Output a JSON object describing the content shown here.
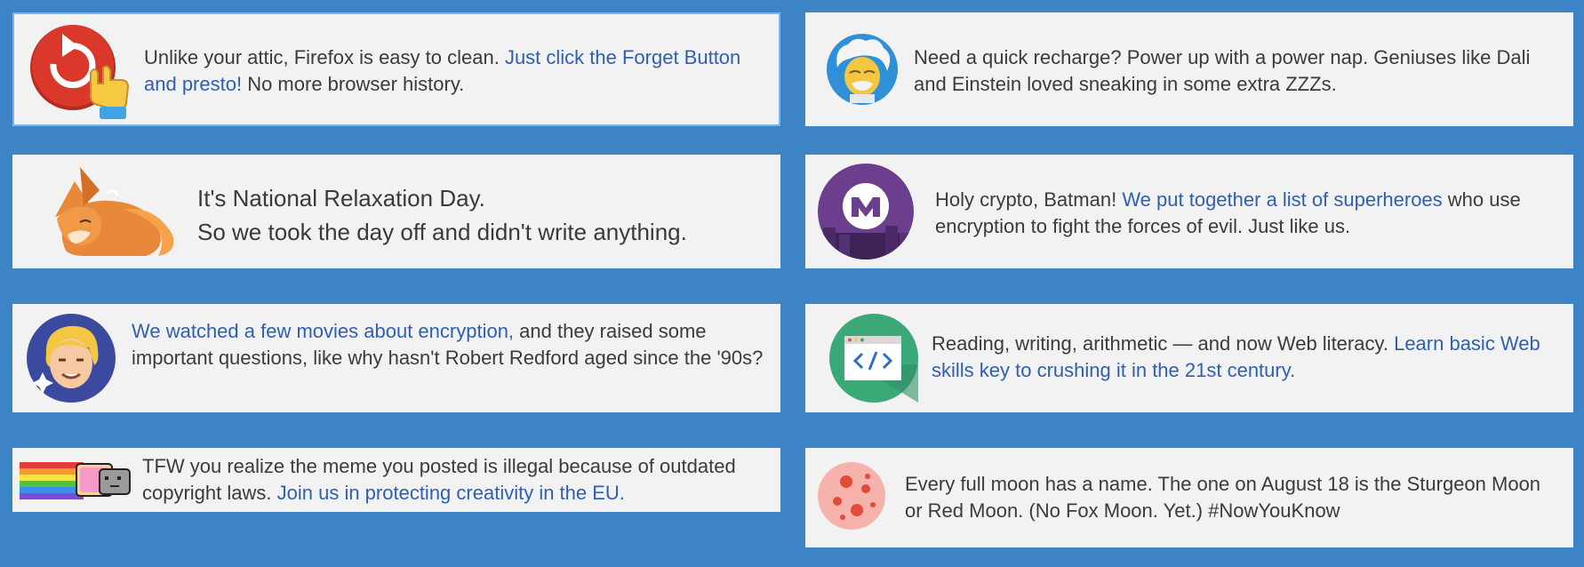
{
  "colors": {
    "background": "#3d84c6",
    "card": "#f2f2f2",
    "link": "#2f5fb3",
    "text": "#3b3b3b"
  },
  "snippets": [
    {
      "icon": "forget-button-icon",
      "text_pre": "Unlike your attic, Firefox is easy to clean. ",
      "link": "Just click the Forget Button and presto!",
      "text_post": " No more browser history."
    },
    {
      "icon": "einstein-icon",
      "text": "Need a quick recharge? Power up with a power nap. Geniuses like Dali and Einstein loved sneaking in some extra ZZZs."
    },
    {
      "icon": "sleeping-fox-icon",
      "line1": "It's National Relaxation Day.",
      "line2": "So we took the day off and didn't write anything."
    },
    {
      "icon": "mozilla-superhero-icon",
      "text_pre": "Holy crypto, Batman! ",
      "link": "We put together a list of superheroes",
      "text_post": " who use encryption to fight the forces of evil. Just like us."
    },
    {
      "icon": "robert-redford-icon",
      "link": "We watched a few movies about encryption,",
      "text_post": " and they raised some important questions, like why hasn't Robert Redford aged since the '90s?"
    },
    {
      "icon": "code-window-icon",
      "text_pre": "Reading, writing, arithmetic — and now Web literacy. ",
      "link": "Learn basic Web skills key to crushing it in the 21st century."
    },
    {
      "icon": "nyan-cat-icon",
      "text_pre": "TFW you realize the meme you posted is illegal because of outdated copyright laws. ",
      "link": "Join us in protecting creativity in the EU."
    },
    {
      "icon": "red-moon-icon",
      "text": "Every full moon has a name. The one on August 18 is the Sturgeon Moon or Red Moon. (No Fox Moon. Yet.) #NowYouKnow"
    }
  ]
}
